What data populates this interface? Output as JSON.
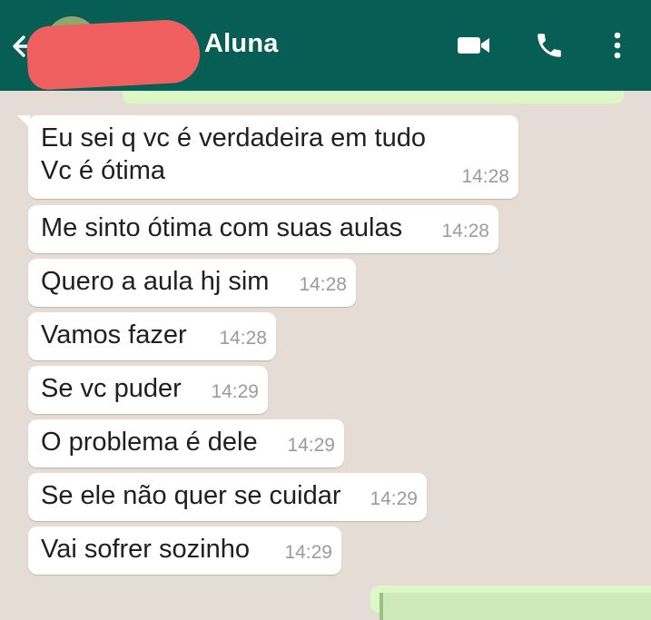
{
  "header": {
    "contact_name": "Aluna",
    "icons": [
      "back-arrow-icon",
      "video-call-icon",
      "phone-icon",
      "more-options-icon"
    ],
    "color": "#075e54"
  },
  "messages": [
    {
      "text_lines": [
        "Eu sei q vc é verdadeira em tudo",
        "Vc é ótima"
      ],
      "time": "14:28"
    },
    {
      "text": "Me sinto ótima com suas aulas",
      "time": "14:28"
    },
    {
      "text": "Quero a aula hj sim",
      "time": "14:28"
    },
    {
      "text": "Vamos fazer",
      "time": "14:28"
    },
    {
      "text": "Se vc puder",
      "time": "14:29"
    },
    {
      "text": "O problema é dele",
      "time": "14:29"
    },
    {
      "text": "Se ele não quer se cuidar",
      "time": "14:29"
    },
    {
      "text": "Vai sofrer sozinho",
      "time": "14:29"
    }
  ],
  "colors": {
    "chat_background": "#e5ddd5",
    "incoming_bubble": "#ffffff",
    "outgoing_bubble": "#dcf8c6"
  }
}
